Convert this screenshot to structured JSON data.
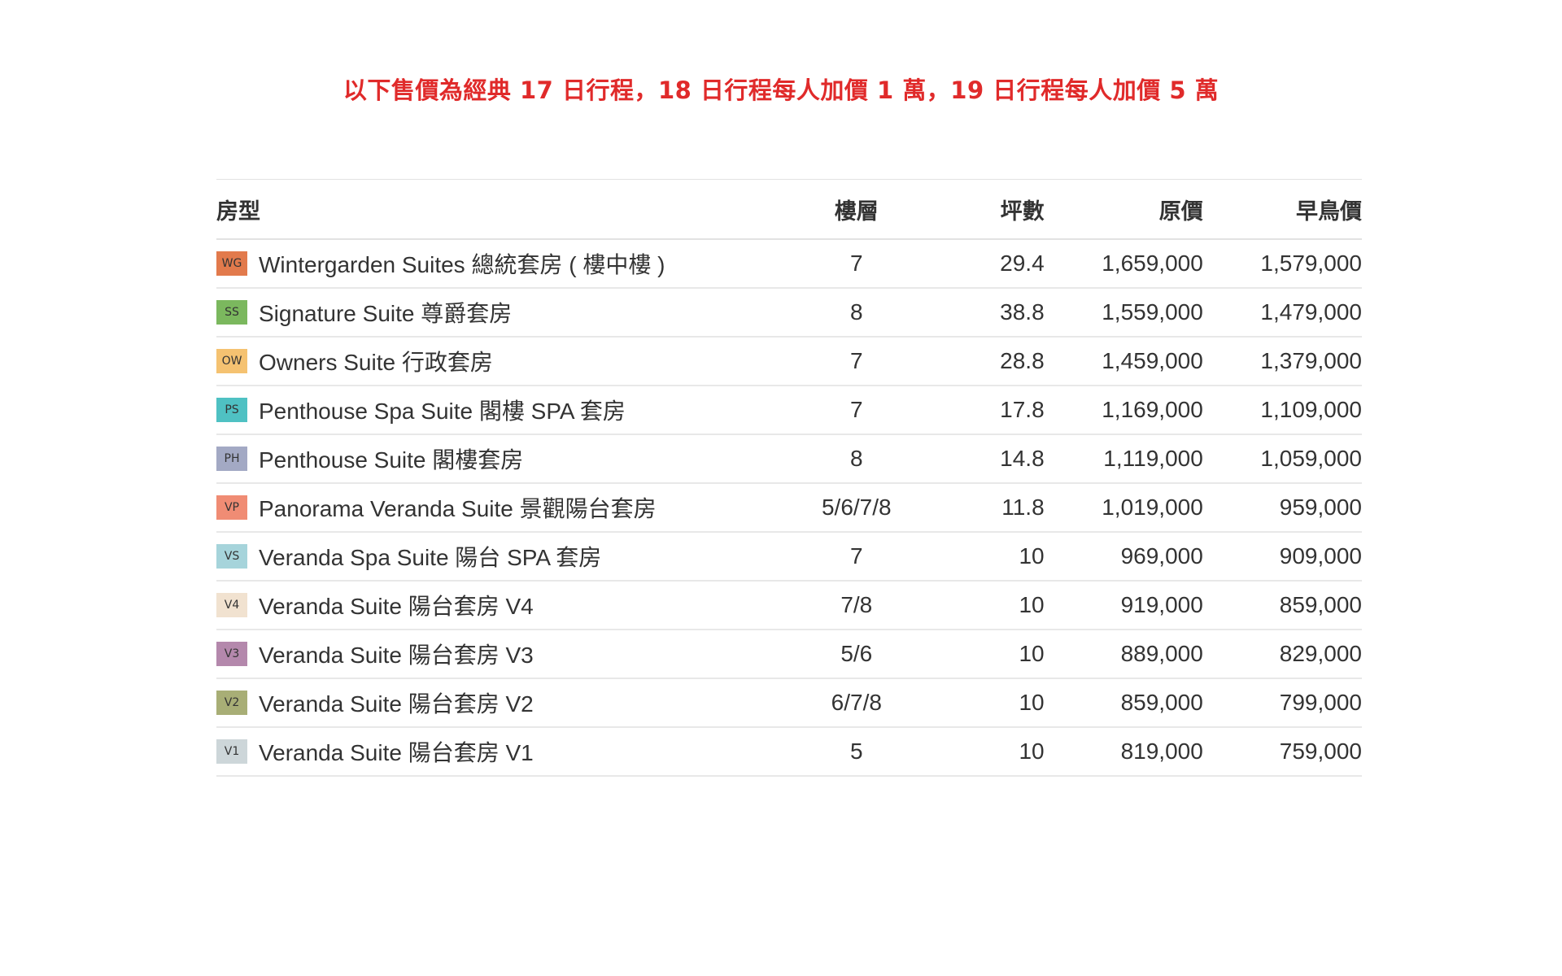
{
  "notice": "以下售價為經典 17 日行程，18 日行程每人加價 1 萬，19 日行程每人加價 5 萬",
  "table": {
    "headers": {
      "type": "房型",
      "floor": "樓層",
      "ping": "坪數",
      "original": "原價",
      "early": "早鳥價"
    },
    "rows": [
      {
        "code": "WG",
        "color": "#e27a4c",
        "name": "Wintergarden Suites 總統套房 ( 樓中樓 )",
        "floor": "7",
        "ping": "29.4",
        "original": "1,659,000",
        "early": "1,579,000"
      },
      {
        "code": "SS",
        "color": "#7bb85e",
        "name": "Signature Suite 尊爵套房",
        "floor": "8",
        "ping": "38.8",
        "original": "1,559,000",
        "early": "1,479,000"
      },
      {
        "code": "OW",
        "color": "#f5c271",
        "name": "Owners Suite 行政套房",
        "floor": "7",
        "ping": "28.8",
        "original": "1,459,000",
        "early": "1,379,000"
      },
      {
        "code": "PS",
        "color": "#4fc1c3",
        "name": "Penthouse Spa Suite 閣樓 SPA 套房",
        "floor": "7",
        "ping": "17.8",
        "original": "1,169,000",
        "early": "1,109,000"
      },
      {
        "code": "PH",
        "color": "#a3a9c4",
        "name": "Penthouse Suite 閣樓套房",
        "floor": "8",
        "ping": "14.8",
        "original": "1,119,000",
        "early": "1,059,000"
      },
      {
        "code": "VP",
        "color": "#f08c74",
        "name": "Panorama Veranda Suite 景觀陽台套房",
        "floor": "5/6/7/8",
        "ping": "11.8",
        "original": "1,019,000",
        "early": "959,000"
      },
      {
        "code": "VS",
        "color": "#a6d4db",
        "name": "Veranda Spa Suite 陽台 SPA 套房",
        "floor": "7",
        "ping": "10",
        "original": "969,000",
        "early": "909,000"
      },
      {
        "code": "V4",
        "color": "#f1e2d0",
        "name": "Veranda Suite 陽台套房 V4",
        "floor": "7/8",
        "ping": "10",
        "original": "919,000",
        "early": "859,000"
      },
      {
        "code": "V3",
        "color": "#b488ac",
        "name": "Veranda Suite 陽台套房 V3",
        "floor": "5/6",
        "ping": "10",
        "original": "889,000",
        "early": "829,000"
      },
      {
        "code": "V2",
        "color": "#a8ae76",
        "name": "Veranda Suite 陽台套房 V2",
        "floor": "6/7/8",
        "ping": "10",
        "original": "859,000",
        "early": "799,000"
      },
      {
        "code": "V1",
        "color": "#cdd6d9",
        "name": "Veranda Suite 陽台套房 V1",
        "floor": "5",
        "ping": "10",
        "original": "819,000",
        "early": "759,000"
      }
    ]
  }
}
